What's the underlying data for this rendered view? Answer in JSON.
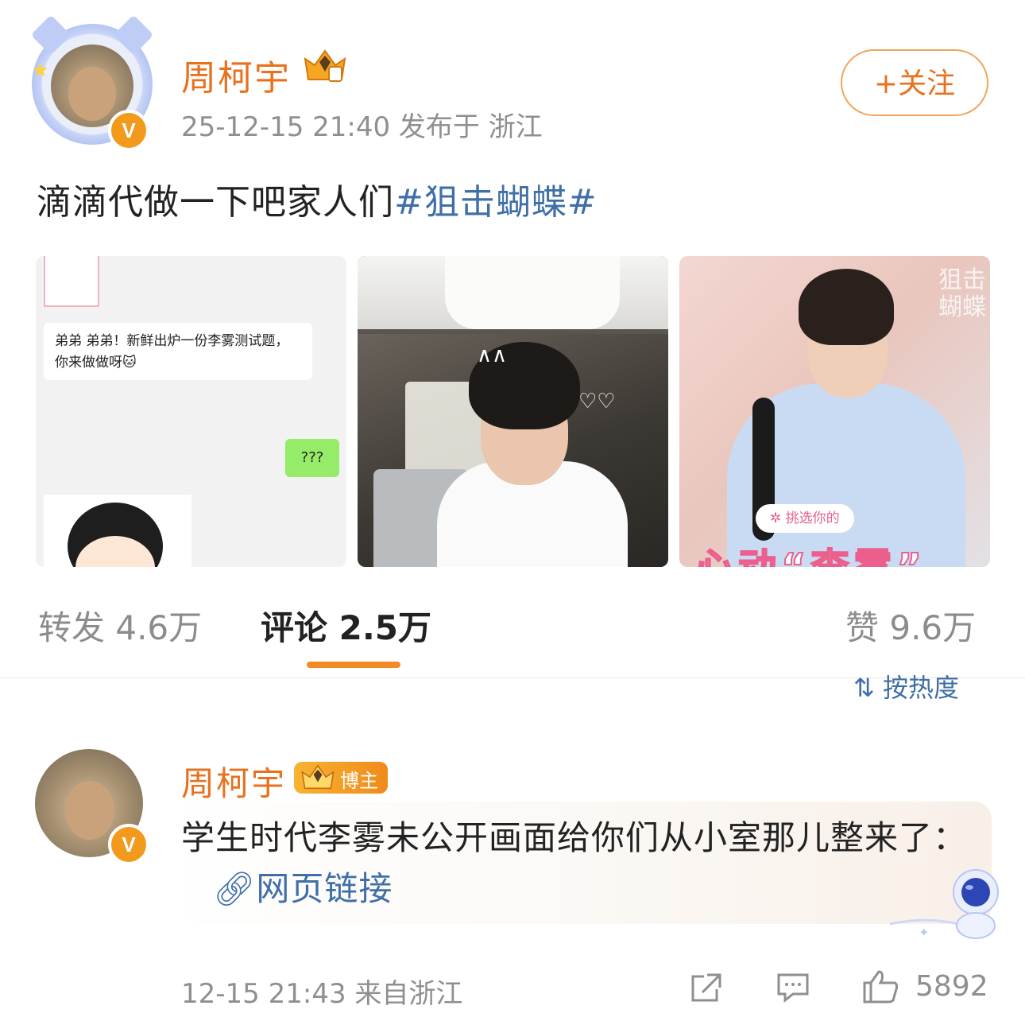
{
  "post": {
    "username": "周柯宇",
    "meta": "25-12-15 21:40   发布于 浙江",
    "follow_label": "+关注",
    "text_main": "滴滴代做一下吧家人们",
    "hashtag": "#狙击蝴蝶#",
    "images": [
      {
        "chat_text": "弟弟 弟弟！新鲜出炉一份李雾测试题，你来做做呀🐱",
        "reply_text": "???"
      },
      {},
      {
        "title_art": "狙击蝴蝶",
        "tag": "✲ 挑选你的",
        "big_title": "心动“李雾”"
      }
    ]
  },
  "stats": {
    "repost": "转发 4.6万",
    "comment": "评论 2.5万",
    "like": "赞 9.6万",
    "sort": "⇅ 按热度"
  },
  "comment": {
    "username": "周柯宇",
    "badge": "博主",
    "text": "学生时代李雾未公开画面给你们从小室那儿整来了：",
    "link": "网页链接",
    "meta": "12-15 21:43 来自浙江",
    "like_count": "5892"
  },
  "colors": {
    "accent": "#e8711d",
    "link": "#3f6fa6",
    "muted": "#8f8f8f",
    "tab_indicator": "#f28a25"
  }
}
